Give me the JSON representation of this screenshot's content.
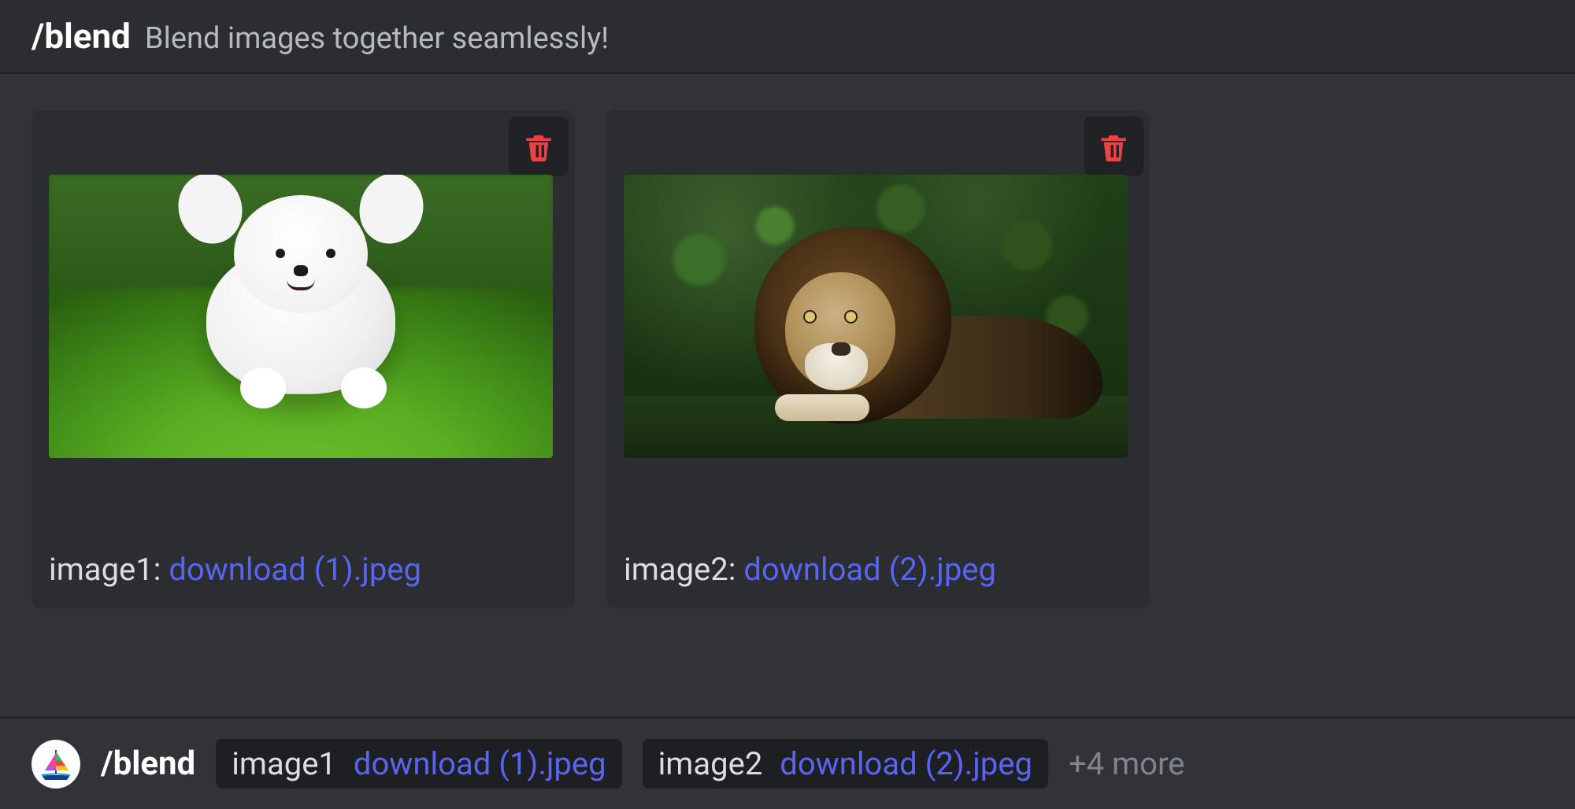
{
  "header": {
    "command": "/blend",
    "description": "Blend images together seamlessly!"
  },
  "cards": [
    {
      "param": "image1",
      "filename": "download (1).jpeg"
    },
    {
      "param": "image2",
      "filename": "download (2).jpeg"
    }
  ],
  "footer": {
    "command": "/blend",
    "params": [
      {
        "name": "image1",
        "filename": "download (1).jpeg"
      },
      {
        "name": "image2",
        "filename": "download (2).jpeg"
      }
    ],
    "more": "+4 more"
  }
}
